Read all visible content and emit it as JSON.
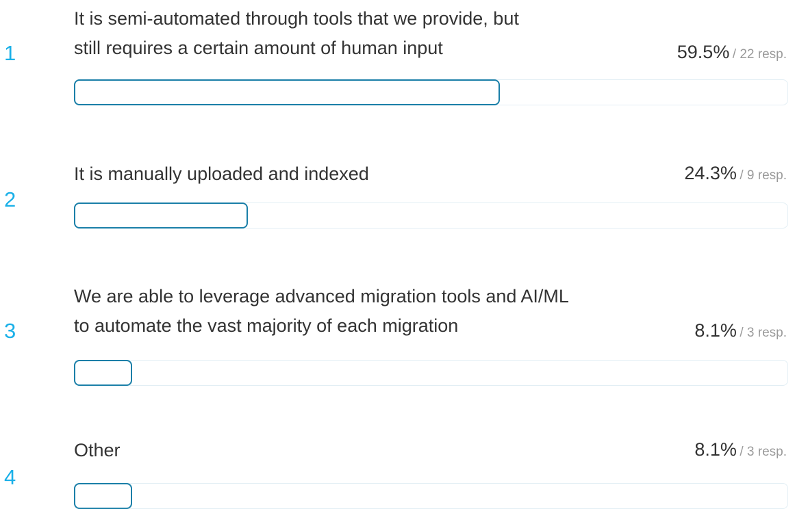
{
  "chart_data": {
    "type": "bar",
    "title": "",
    "xlabel": "",
    "ylabel": "",
    "ylim": [
      0,
      100
    ],
    "categories": [
      "It is semi-automated through tools that we provide, but still requires a certain amount of human input",
      "It is manually uploaded and indexed",
      "We are able to leverage advanced migration tools and AI/ML to automate the vast majority of each migration",
      "Other"
    ],
    "values": [
      59.5,
      24.3,
      8.1,
      8.1
    ],
    "responses": [
      22,
      9,
      3,
      3
    ],
    "items": [
      {
        "rank": "1",
        "lines": [
          "It is semi-automated through tools that we provide, but",
          "still requires a certain amount of human input"
        ],
        "percent_label": "59.5%",
        "resp_label": "/ 22 resp.",
        "value": 59.5
      },
      {
        "rank": "2",
        "lines": [
          "It is manually uploaded and indexed"
        ],
        "percent_label": "24.3%",
        "resp_label": "/ 9 resp.",
        "value": 24.3
      },
      {
        "rank": "3",
        "lines": [
          "We are able to leverage advanced migration tools and AI/ML",
          "to automate the vast majority of each migration"
        ],
        "percent_label": "8.1%",
        "resp_label": "/ 3 resp.",
        "value": 8.1
      },
      {
        "rank": "4",
        "lines": [
          "Other"
        ],
        "percent_label": "8.1%",
        "resp_label": "/ 3 resp.",
        "value": 8.1
      }
    ]
  },
  "colors": {
    "rank": "#1ab0e8",
    "bar_border": "#1a7fa8",
    "track_border": "#e2eef4",
    "text": "#333333",
    "muted": "#9a9a9a"
  }
}
